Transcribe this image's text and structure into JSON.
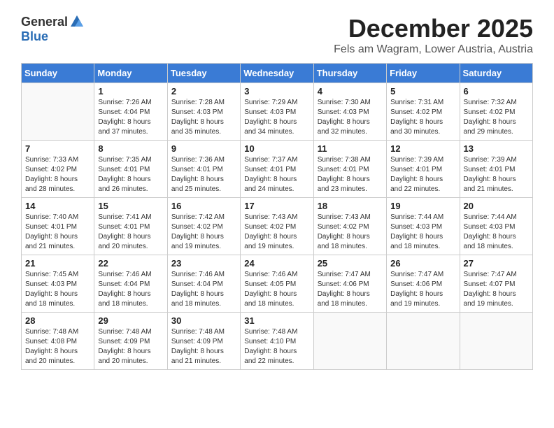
{
  "logo": {
    "general": "General",
    "blue": "Blue"
  },
  "title": "December 2025",
  "location": "Fels am Wagram, Lower Austria, Austria",
  "days_of_week": [
    "Sunday",
    "Monday",
    "Tuesday",
    "Wednesday",
    "Thursday",
    "Friday",
    "Saturday"
  ],
  "weeks": [
    [
      {
        "day": "",
        "info": ""
      },
      {
        "day": "1",
        "info": "Sunrise: 7:26 AM\nSunset: 4:04 PM\nDaylight: 8 hours\nand 37 minutes."
      },
      {
        "day": "2",
        "info": "Sunrise: 7:28 AM\nSunset: 4:03 PM\nDaylight: 8 hours\nand 35 minutes."
      },
      {
        "day": "3",
        "info": "Sunrise: 7:29 AM\nSunset: 4:03 PM\nDaylight: 8 hours\nand 34 minutes."
      },
      {
        "day": "4",
        "info": "Sunrise: 7:30 AM\nSunset: 4:03 PM\nDaylight: 8 hours\nand 32 minutes."
      },
      {
        "day": "5",
        "info": "Sunrise: 7:31 AM\nSunset: 4:02 PM\nDaylight: 8 hours\nand 30 minutes."
      },
      {
        "day": "6",
        "info": "Sunrise: 7:32 AM\nSunset: 4:02 PM\nDaylight: 8 hours\nand 29 minutes."
      }
    ],
    [
      {
        "day": "7",
        "info": "Sunrise: 7:33 AM\nSunset: 4:02 PM\nDaylight: 8 hours\nand 28 minutes."
      },
      {
        "day": "8",
        "info": "Sunrise: 7:35 AM\nSunset: 4:01 PM\nDaylight: 8 hours\nand 26 minutes."
      },
      {
        "day": "9",
        "info": "Sunrise: 7:36 AM\nSunset: 4:01 PM\nDaylight: 8 hours\nand 25 minutes."
      },
      {
        "day": "10",
        "info": "Sunrise: 7:37 AM\nSunset: 4:01 PM\nDaylight: 8 hours\nand 24 minutes."
      },
      {
        "day": "11",
        "info": "Sunrise: 7:38 AM\nSunset: 4:01 PM\nDaylight: 8 hours\nand 23 minutes."
      },
      {
        "day": "12",
        "info": "Sunrise: 7:39 AM\nSunset: 4:01 PM\nDaylight: 8 hours\nand 22 minutes."
      },
      {
        "day": "13",
        "info": "Sunrise: 7:39 AM\nSunset: 4:01 PM\nDaylight: 8 hours\nand 21 minutes."
      }
    ],
    [
      {
        "day": "14",
        "info": "Sunrise: 7:40 AM\nSunset: 4:01 PM\nDaylight: 8 hours\nand 21 minutes."
      },
      {
        "day": "15",
        "info": "Sunrise: 7:41 AM\nSunset: 4:01 PM\nDaylight: 8 hours\nand 20 minutes."
      },
      {
        "day": "16",
        "info": "Sunrise: 7:42 AM\nSunset: 4:02 PM\nDaylight: 8 hours\nand 19 minutes."
      },
      {
        "day": "17",
        "info": "Sunrise: 7:43 AM\nSunset: 4:02 PM\nDaylight: 8 hours\nand 19 minutes."
      },
      {
        "day": "18",
        "info": "Sunrise: 7:43 AM\nSunset: 4:02 PM\nDaylight: 8 hours\nand 18 minutes."
      },
      {
        "day": "19",
        "info": "Sunrise: 7:44 AM\nSunset: 4:03 PM\nDaylight: 8 hours\nand 18 minutes."
      },
      {
        "day": "20",
        "info": "Sunrise: 7:44 AM\nSunset: 4:03 PM\nDaylight: 8 hours\nand 18 minutes."
      }
    ],
    [
      {
        "day": "21",
        "info": "Sunrise: 7:45 AM\nSunset: 4:03 PM\nDaylight: 8 hours\nand 18 minutes."
      },
      {
        "day": "22",
        "info": "Sunrise: 7:46 AM\nSunset: 4:04 PM\nDaylight: 8 hours\nand 18 minutes."
      },
      {
        "day": "23",
        "info": "Sunrise: 7:46 AM\nSunset: 4:04 PM\nDaylight: 8 hours\nand 18 minutes."
      },
      {
        "day": "24",
        "info": "Sunrise: 7:46 AM\nSunset: 4:05 PM\nDaylight: 8 hours\nand 18 minutes."
      },
      {
        "day": "25",
        "info": "Sunrise: 7:47 AM\nSunset: 4:06 PM\nDaylight: 8 hours\nand 18 minutes."
      },
      {
        "day": "26",
        "info": "Sunrise: 7:47 AM\nSunset: 4:06 PM\nDaylight: 8 hours\nand 19 minutes."
      },
      {
        "day": "27",
        "info": "Sunrise: 7:47 AM\nSunset: 4:07 PM\nDaylight: 8 hours\nand 19 minutes."
      }
    ],
    [
      {
        "day": "28",
        "info": "Sunrise: 7:48 AM\nSunset: 4:08 PM\nDaylight: 8 hours\nand 20 minutes."
      },
      {
        "day": "29",
        "info": "Sunrise: 7:48 AM\nSunset: 4:09 PM\nDaylight: 8 hours\nand 20 minutes."
      },
      {
        "day": "30",
        "info": "Sunrise: 7:48 AM\nSunset: 4:09 PM\nDaylight: 8 hours\nand 21 minutes."
      },
      {
        "day": "31",
        "info": "Sunrise: 7:48 AM\nSunset: 4:10 PM\nDaylight: 8 hours\nand 22 minutes."
      },
      {
        "day": "",
        "info": ""
      },
      {
        "day": "",
        "info": ""
      },
      {
        "day": "",
        "info": ""
      }
    ]
  ]
}
